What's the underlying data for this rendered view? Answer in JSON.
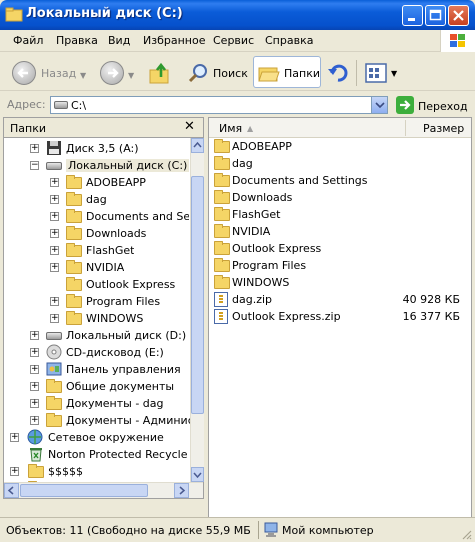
{
  "window": {
    "title": "Локальный диск (C:)"
  },
  "menu": [
    "Файл",
    "Правка",
    "Вид",
    "Избранное",
    "Сервис",
    "Справка"
  ],
  "toolbar": {
    "back": "Назад",
    "search": "Поиск",
    "folders": "Папки"
  },
  "address": {
    "label": "Адрес:",
    "value": "C:\\",
    "go": "Переход"
  },
  "folders_pane": {
    "title": "Папки",
    "tree": [
      {
        "label": "Диск 3,5 (A:)",
        "icon": "floppy-icon"
      },
      {
        "label": "Локальный диск (C:)",
        "icon": "drive-icon"
      },
      {
        "label": "ADOBEAPP",
        "icon": "folder-icon"
      },
      {
        "label": "dag",
        "icon": "folder-icon"
      },
      {
        "label": "Documents and Settings",
        "icon": "folder-icon"
      },
      {
        "label": "Downloads",
        "icon": "folder-icon"
      },
      {
        "label": "FlashGet",
        "icon": "folder-icon"
      },
      {
        "label": "NVIDIA",
        "icon": "folder-icon"
      },
      {
        "label": "Outlook Express",
        "icon": "folder-icon"
      },
      {
        "label": "Program Files",
        "icon": "folder-icon"
      },
      {
        "label": "WINDOWS",
        "icon": "folder-icon"
      },
      {
        "label": "Локальный диск (D:)",
        "icon": "drive-icon"
      },
      {
        "label": "CD-дисковод (E:)",
        "icon": "cd-icon"
      },
      {
        "label": "Панель управления",
        "icon": "control-panel-icon"
      },
      {
        "label": "Общие документы",
        "icon": "folder-icon"
      },
      {
        "label": "Документы - dag",
        "icon": "folder-icon"
      },
      {
        "label": "Документы - Администратор",
        "icon": "folder-icon"
      },
      {
        "label": "Сетевое окружение",
        "icon": "network-icon"
      },
      {
        "label": "Norton Protected Recycle Bin",
        "icon": "recycle-bin-icon"
      },
      {
        "label": "$$$$$",
        "icon": "folder-icon"
      },
      {
        "label": "$$$$$$$",
        "icon": "folder-icon"
      }
    ]
  },
  "list": {
    "columns": {
      "name": "Имя",
      "size": "Размер"
    },
    "items": [
      {
        "name": "ADOBEAPP",
        "size": "",
        "icon": "folder-icon"
      },
      {
        "name": "dag",
        "size": "",
        "icon": "folder-icon"
      },
      {
        "name": "Documents and Settings",
        "size": "",
        "icon": "folder-icon"
      },
      {
        "name": "Downloads",
        "size": "",
        "icon": "folder-icon"
      },
      {
        "name": "FlashGet",
        "size": "",
        "icon": "folder-icon"
      },
      {
        "name": "NVIDIA",
        "size": "",
        "icon": "folder-icon"
      },
      {
        "name": "Outlook Express",
        "size": "",
        "icon": "folder-icon"
      },
      {
        "name": "Program Files",
        "size": "",
        "icon": "folder-icon"
      },
      {
        "name": "WINDOWS",
        "size": "",
        "icon": "folder-icon"
      },
      {
        "name": "dag.zip",
        "size": "40 928 КБ",
        "icon": "zip-icon"
      },
      {
        "name": "Outlook Express.zip",
        "size": "16 377 КБ",
        "icon": "zip-icon"
      }
    ]
  },
  "status": {
    "left": "Объектов: 11 (Свободно на диске 55,9 МБ",
    "right": "Мой компьютер"
  },
  "colors": {
    "titlebar": "#0651cc",
    "chrome": "#ece9d8",
    "folder": "#f5d566",
    "go": "#3cae3c"
  }
}
